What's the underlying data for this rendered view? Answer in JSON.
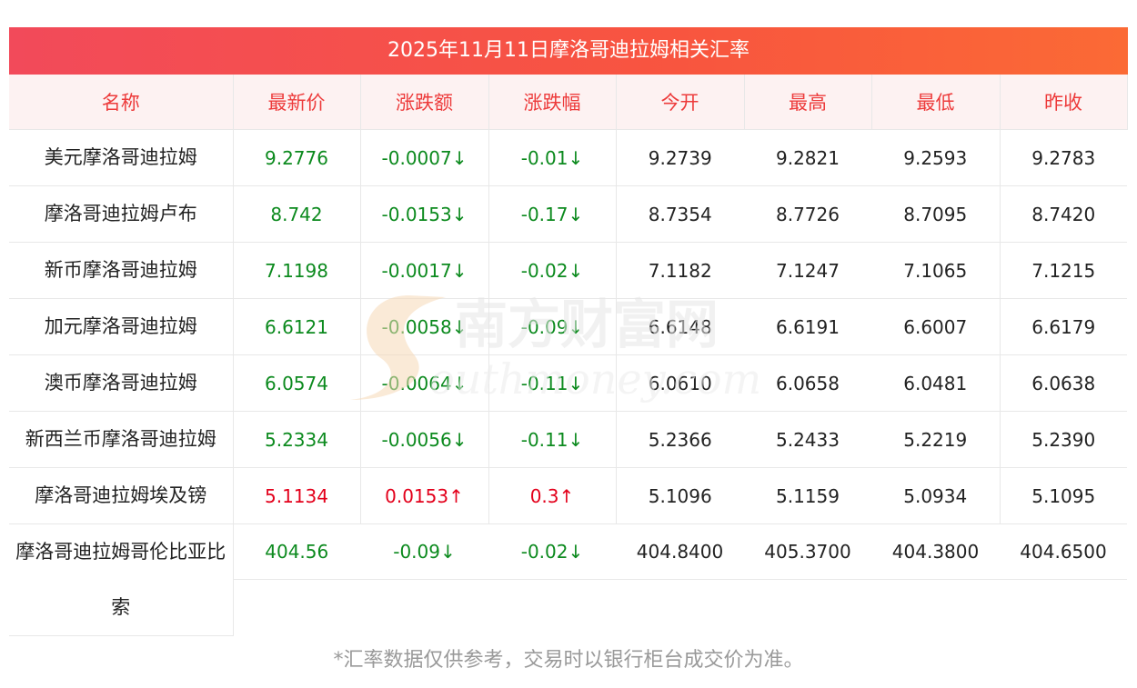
{
  "title": "2025年11月11日摩洛哥迪拉姆相关汇率",
  "columns": [
    "名称",
    "最新价",
    "涨跌额",
    "涨跌幅",
    "今开",
    "最高",
    "最低",
    "昨收"
  ],
  "rows": [
    {
      "name": "美元摩洛哥迪拉姆",
      "latest": "9.2776",
      "change": "-0.0007↓",
      "pct": "-0.01↓",
      "open": "9.2739",
      "high": "9.2821",
      "low": "9.2593",
      "prev": "9.2783",
      "dir": "down"
    },
    {
      "name": "摩洛哥迪拉姆卢布",
      "latest": "8.742",
      "change": "-0.0153↓",
      "pct": "-0.17↓",
      "open": "8.7354",
      "high": "8.7726",
      "low": "8.7095",
      "prev": "8.7420",
      "dir": "down"
    },
    {
      "name": "新币摩洛哥迪拉姆",
      "latest": "7.1198",
      "change": "-0.0017↓",
      "pct": "-0.02↓",
      "open": "7.1182",
      "high": "7.1247",
      "low": "7.1065",
      "prev": "7.1215",
      "dir": "down"
    },
    {
      "name": "加元摩洛哥迪拉姆",
      "latest": "6.6121",
      "change": "-0.0058↓",
      "pct": "-0.09↓",
      "open": "6.6148",
      "high": "6.6191",
      "low": "6.6007",
      "prev": "6.6179",
      "dir": "down"
    },
    {
      "name": "澳币摩洛哥迪拉姆",
      "latest": "6.0574",
      "change": "-0.0064↓",
      "pct": "-0.11↓",
      "open": "6.0610",
      "high": "6.0658",
      "low": "6.0481",
      "prev": "6.0638",
      "dir": "down"
    },
    {
      "name": "新西兰币摩洛哥迪拉姆",
      "latest": "5.2334",
      "change": "-0.0056↓",
      "pct": "-0.11↓",
      "open": "5.2366",
      "high": "5.2433",
      "low": "5.2219",
      "prev": "5.2390",
      "dir": "down"
    },
    {
      "name": "摩洛哥迪拉姆埃及镑",
      "latest": "5.1134",
      "change": "0.0153↑",
      "pct": "0.3↑",
      "open": "5.1096",
      "high": "5.1159",
      "low": "5.0934",
      "prev": "5.1095",
      "dir": "up"
    },
    {
      "name": "摩洛哥迪拉姆哥伦比亚比索",
      "latest": "404.56",
      "change": "-0.09↓",
      "pct": "-0.02↓",
      "open": "404.8400",
      "high": "405.3700",
      "low": "404.3800",
      "prev": "404.6500",
      "dir": "down"
    }
  ],
  "watermark": {
    "cn": "南方财富网",
    "en": "outhmoney.com"
  },
  "note": "*汇率数据仅供参考，交易时以银行柜台成交价为准。"
}
